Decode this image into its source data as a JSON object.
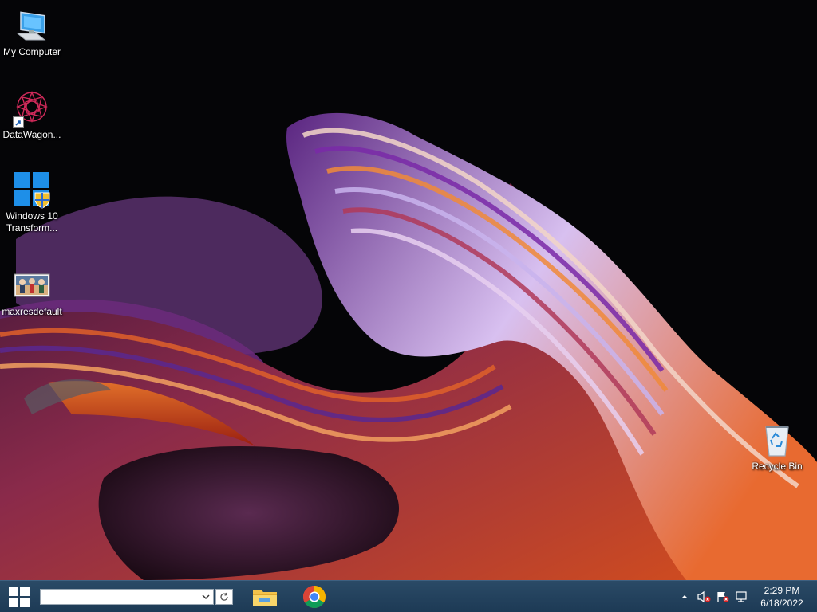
{
  "desktop": {
    "icons": [
      {
        "label": "My Computer",
        "icon": "computer-icon"
      },
      {
        "label": "DataWagon...",
        "icon": "datawagon-icon"
      },
      {
        "label": "Windows 10 Transform...",
        "icon": "windows-transformation-icon"
      },
      {
        "label": "maxresdefault",
        "icon": "image-file-icon"
      },
      {
        "label": "Recycle Bin",
        "icon": "recycle-bin-icon"
      }
    ]
  },
  "taskbar": {
    "start_icon": "windows-logo-icon",
    "search": {
      "value": "",
      "placeholder": ""
    },
    "apps": [
      {
        "icon": "file-explorer-icon"
      },
      {
        "icon": "chrome-icon"
      }
    ],
    "tray": {
      "icons": [
        "show-hidden-icons-chevron",
        "volume-muted-icon",
        "action-center-flag-icon",
        "network-icon"
      ]
    },
    "clock": {
      "time": "2:29 PM",
      "date": "6/18/2022"
    }
  },
  "colors": {
    "taskbar_bg": "#1d3a55",
    "desktop_bg": "#050507",
    "swirl_orange": "#e0501c",
    "swirl_purple": "#6a2a9a",
    "swirl_lilac": "#c8b0e8"
  }
}
